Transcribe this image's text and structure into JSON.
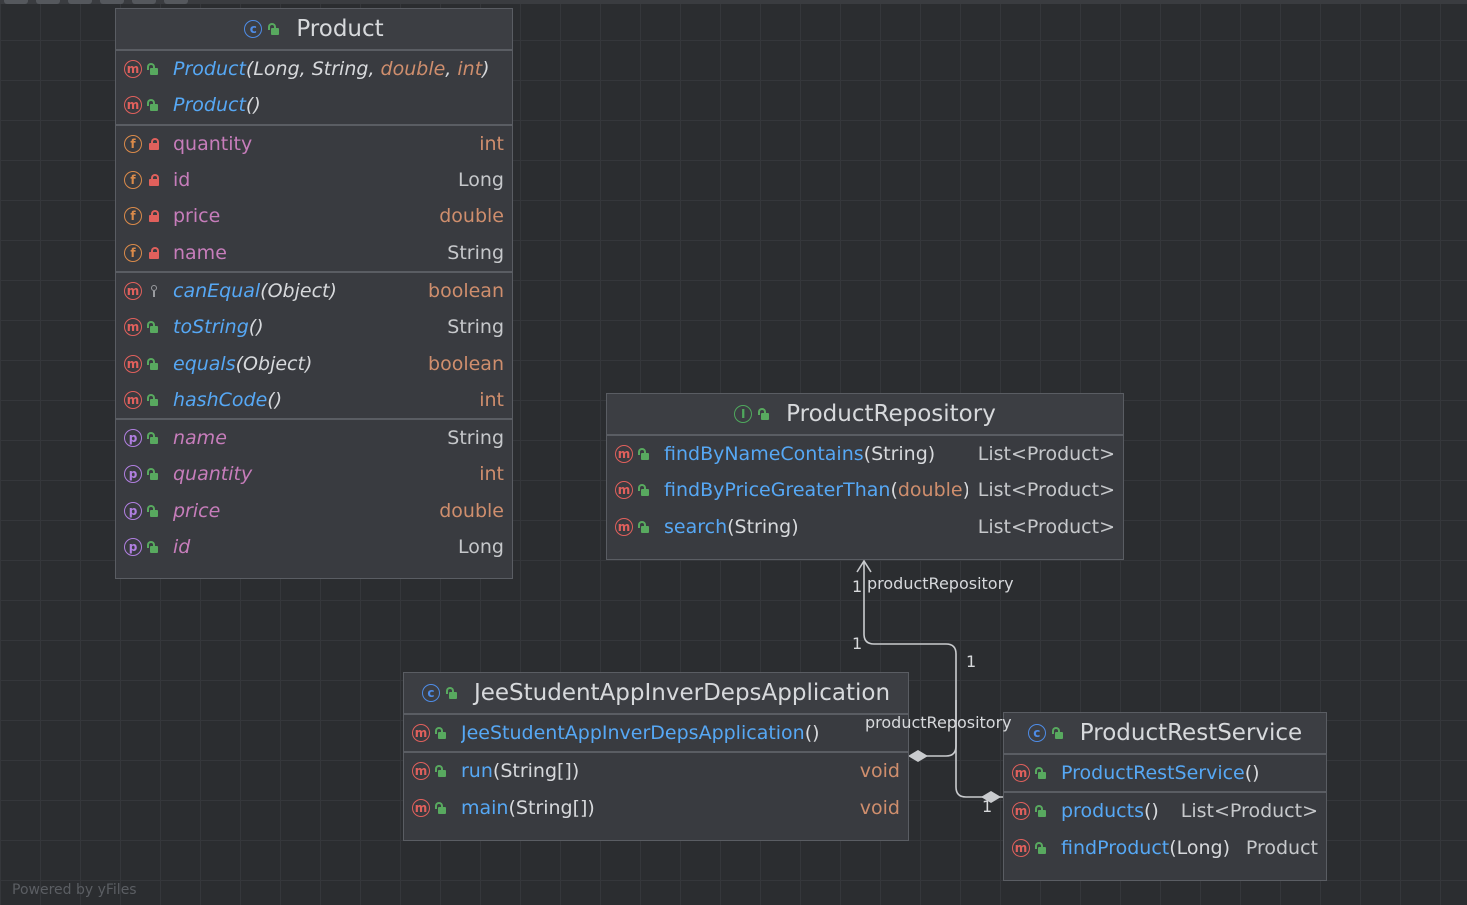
{
  "watermark": "Powered by yFiles",
  "nodes": {
    "product": {
      "title": "Product",
      "constructors": [
        {
          "name": "Product",
          "params": [
            "Long",
            "String",
            "double",
            "int"
          ]
        },
        {
          "name": "Product",
          "params": []
        }
      ],
      "fields": [
        {
          "name": "quantity",
          "type": "int"
        },
        {
          "name": "id",
          "type": "Long"
        },
        {
          "name": "price",
          "type": "double"
        },
        {
          "name": "name",
          "type": "String"
        }
      ],
      "methods": [
        {
          "name": "canEqual",
          "params": "Object",
          "type": "boolean"
        },
        {
          "name": "toString",
          "params": "",
          "type": "String"
        },
        {
          "name": "equals",
          "params": "Object",
          "type": "boolean"
        },
        {
          "name": "hashCode",
          "params": "",
          "type": "int"
        }
      ],
      "properties": [
        {
          "name": "name",
          "type": "String"
        },
        {
          "name": "quantity",
          "type": "int"
        },
        {
          "name": "price",
          "type": "double"
        },
        {
          "name": "id",
          "type": "Long"
        }
      ]
    },
    "repository": {
      "title": "ProductRepository",
      "methods": [
        {
          "name": "findByNameContains",
          "params": "(String)",
          "type": "List<Product>"
        },
        {
          "name": "findByPriceGreaterThan",
          "params_open": "(",
          "params_prim": "double",
          "params_close": ")",
          "type": "List<Product>"
        },
        {
          "name": "search",
          "params": "(String)",
          "type": "List<Product>"
        }
      ]
    },
    "app": {
      "title": "JeeStudentAppInverDepsApplication",
      "constructor": {
        "name": "JeeStudentAppInverDepsApplication",
        "params": "()"
      },
      "methods": [
        {
          "name": "run",
          "params": "(String[])",
          "type": "void"
        },
        {
          "name": "main",
          "params": "(String[])",
          "type": "void"
        }
      ]
    },
    "service": {
      "title": "ProductRestService",
      "constructor": {
        "name": "ProductRestService",
        "params": "()"
      },
      "methods": [
        {
          "name": "products",
          "params": "()",
          "type": "List<Product>"
        },
        {
          "name": "findProduct",
          "params": "(Long)",
          "type": "Product"
        }
      ]
    }
  },
  "edges": {
    "label_top": "productRepository",
    "label_mid": "productRepository",
    "mult_top": "1",
    "mult_left": "1",
    "mult_right": "1",
    "mult_bottom": "1"
  }
}
